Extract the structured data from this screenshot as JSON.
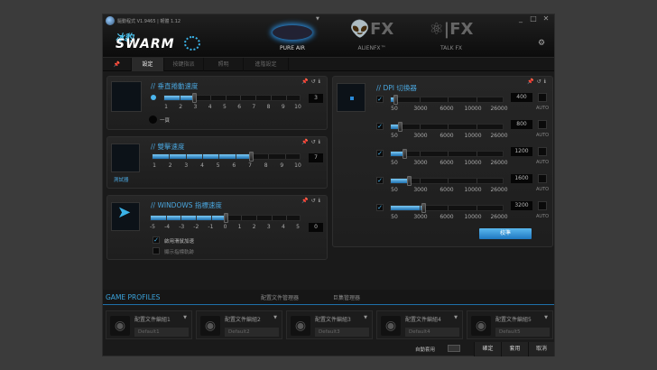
{
  "window": {
    "title": "驅動程式 V1.9465 | 韌體 1.12",
    "brand_cn": "冰豹",
    "brand": "SWARM",
    "minimize": "_",
    "maximize": "□",
    "close": "✕"
  },
  "devices": [
    {
      "label": "PURE AIR",
      "active": true
    },
    {
      "label": "ALIENFX™",
      "icon": "👽FX"
    },
    {
      "label": "TALK FX",
      "icon": "⚛|FX"
    }
  ],
  "tabs": [
    "設定",
    "按鍵指派",
    "照明",
    "進階設定"
  ],
  "scroll": {
    "title": "// 垂直捲動速度",
    "min": 1,
    "max": 10,
    "value": 3,
    "value_text": "3",
    "labels": [
      "1",
      "2",
      "3",
      "4",
      "5",
      "6",
      "7",
      "8",
      "9",
      "10"
    ],
    "radio_label": "一頁"
  },
  "dblclick": {
    "title": "// 雙擊速度",
    "min": 1,
    "max": 10,
    "value": 7,
    "value_text": "7",
    "labels": [
      "1",
      "2",
      "3",
      "4",
      "5",
      "6",
      "7",
      "8",
      "9",
      "10"
    ],
    "tester": "測試器"
  },
  "pointer": {
    "title": "// WINDOWS 指標速度",
    "min": -5,
    "max": 5,
    "value": 0,
    "value_text": "0",
    "labels": [
      "-5",
      "-4",
      "-3",
      "-2",
      "-1",
      "0",
      "1",
      "2",
      "3",
      "4",
      "5"
    ],
    "accel_label": "啟用滑鼠加速",
    "accel_checked": true,
    "trail_label": "顯示指標軌跡",
    "trail_checked": false
  },
  "dpi": {
    "title": "// DPI 切換器",
    "labels": [
      "50",
      "3000",
      "6000",
      "10000",
      "26000"
    ],
    "auto": "AUTO",
    "calibrate": "校準",
    "rows": [
      {
        "value": "400",
        "fraction": 0.02
      },
      {
        "value": "800",
        "fraction": 0.06
      },
      {
        "value": "1200",
        "fraction": 0.1
      },
      {
        "value": "1600",
        "fraction": 0.14
      },
      {
        "value": "3200",
        "fraction": 0.27
      }
    ]
  },
  "profiles": {
    "title": "GAME PROFILES",
    "tabs": [
      "配置文件管理器",
      "巨集管理器"
    ],
    "cards": [
      {
        "name": "配置文件編組1",
        "default": "Default1"
      },
      {
        "name": "配置文件編組2",
        "default": "Default2"
      },
      {
        "name": "配置文件編組3",
        "default": "Default3"
      },
      {
        "name": "配置文件編組4",
        "default": "Default4"
      },
      {
        "name": "配置文件編組5",
        "default": "Default5"
      }
    ]
  },
  "footer": {
    "auto_apply": "自動套用",
    "ok": "確定",
    "apply": "套用",
    "cancel": "取消"
  },
  "colors": {
    "accent": "#4aa6de"
  }
}
